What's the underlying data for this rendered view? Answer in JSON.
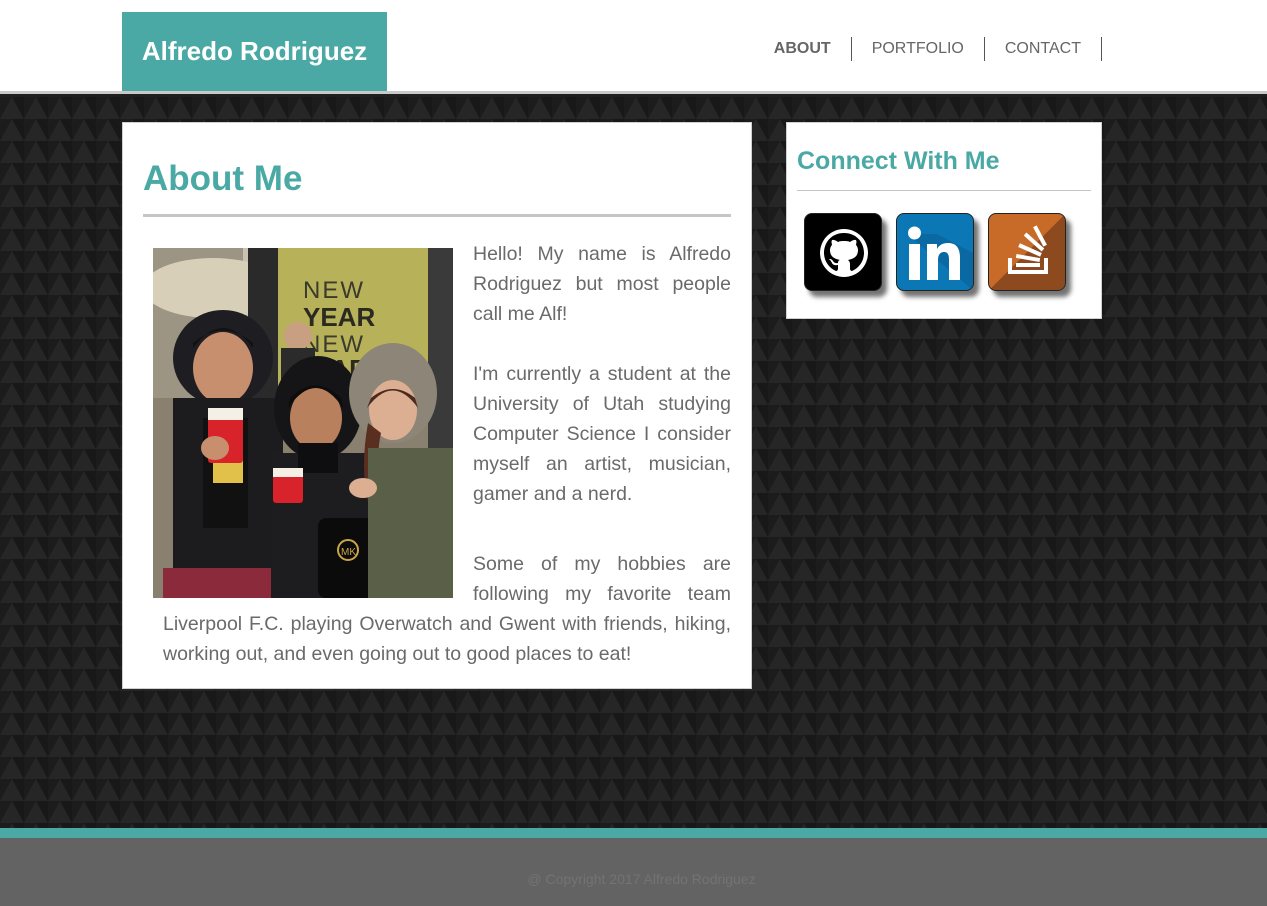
{
  "header": {
    "brand": "Alfredo Rodriguez",
    "brand_color": "#4aa9a4",
    "nav": [
      {
        "label": "ABOUT",
        "active": true
      },
      {
        "label": "PORTFOLIO",
        "active": false
      },
      {
        "label": "CONTACT",
        "active": false
      }
    ]
  },
  "about": {
    "title": "About Me",
    "paragraphs": [
      "Hello! My name is Alfredo Rodriguez but most people call me Alf!",
      "I'm currently a student at the University of Utah studying Computer Science I consider myself an artist, musician, gamer and a nerd.",
      "Some of my hobbies are following my favorite team Liverpool F.C. playing Overwatch and Gwent with friends, hiking, working out, and even going out to good places to eat!"
    ],
    "photo": {
      "icon": "photo-of-three-friends",
      "sign_text": [
        "NEW",
        "YEAR",
        "NEW",
        "EAR"
      ],
      "bag_logo": "MK"
    }
  },
  "connect": {
    "title": "Connect With Me",
    "links": [
      {
        "name": "github",
        "icon": "github-icon",
        "color": "#000000"
      },
      {
        "name": "linkedin",
        "icon": "linkedin-icon",
        "color": "#0c77b5"
      },
      {
        "name": "stackoverflow",
        "icon": "stackoverflow-icon",
        "color": "#c86a28"
      }
    ]
  },
  "footer": {
    "copyright": "@ Copyright 2017 Alfredo Rodriguez",
    "accent": "#4aa9a4"
  }
}
